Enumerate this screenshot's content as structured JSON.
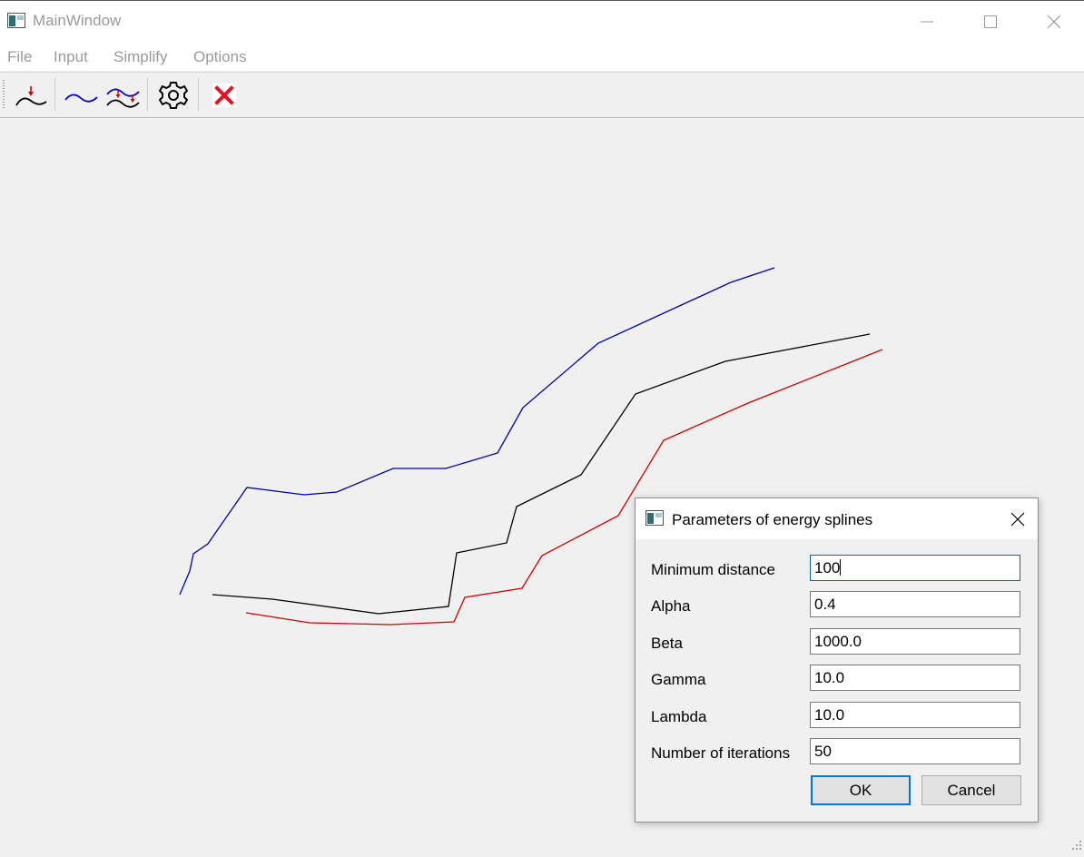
{
  "window": {
    "title": "MainWindow"
  },
  "menu": {
    "items": [
      "File",
      "Input",
      "Simplify",
      "Options"
    ]
  },
  "toolbar": {
    "buttons": [
      "load-input-icon",
      "simplify-curve-icon",
      "simplify-energy-splines-icon",
      "settings-icon",
      "clear-icon"
    ],
    "clear_color": "#e81123"
  },
  "canvas": {
    "colors": {
      "blue_line": "#0000aa",
      "black_line": "#000000",
      "red_line": "#d40000"
    }
  },
  "dialog": {
    "title": "Parameters of energy splines",
    "fields": [
      {
        "label": "Minimum distance",
        "value": "100"
      },
      {
        "label": "Alpha",
        "value": "0.4"
      },
      {
        "label": "Beta",
        "value": "1000.0"
      },
      {
        "label": "Gamma",
        "value": "10.0"
      },
      {
        "label": "Lambda",
        "value": "10.0"
      },
      {
        "label": "Number of iterations",
        "value": "50"
      }
    ],
    "ok_label": "OK",
    "cancel_label": "Cancel",
    "accent": "#0078d7"
  }
}
